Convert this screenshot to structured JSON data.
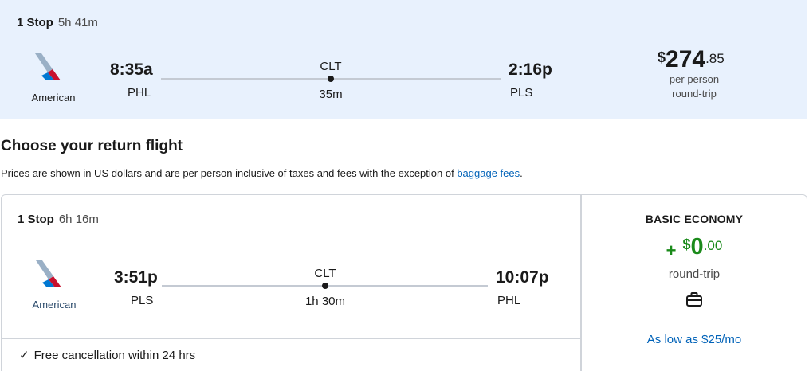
{
  "outbound": {
    "stops": "1 Stop",
    "duration": "5h 41m",
    "airline": "American",
    "depart_time": "8:35a",
    "depart_code": "PHL",
    "layover_code": "CLT",
    "layover_duration": "35m",
    "arrive_time": "2:16p",
    "arrive_code": "PLS",
    "price_currency": "$",
    "price_whole": "274",
    "price_cents": ".85",
    "price_note_1": "per person",
    "price_note_2": "round-trip"
  },
  "section": {
    "title": "Choose your return flight",
    "disclaimer": "Prices are shown in US dollars and are per person inclusive of taxes and fees with the exception of ",
    "baggage_link": "baggage fees",
    "disclaimer_end": "."
  },
  "return_flight": {
    "stops": "1 Stop",
    "duration": "6h 16m",
    "airline": "American",
    "depart_time": "3:51p",
    "depart_code": "PLS",
    "layover_code": "CLT",
    "layover_duration": "1h 30m",
    "arrive_time": "10:07p",
    "arrive_code": "PHL",
    "free_cancel": "Free cancellation within 24 hrs"
  },
  "fare": {
    "name": "BASIC ECONOMY",
    "plus": "+",
    "currency": "$",
    "whole": "0",
    "cents": ".00",
    "trip": "round-trip",
    "low_as": "As low as $25/mo",
    "price_color": "#1a8a1a",
    "link_color": "#0062b8"
  },
  "icons": {
    "airline_logo": "american-airlines-logo",
    "bag": "briefcase-icon",
    "check": "checkmark-icon"
  }
}
